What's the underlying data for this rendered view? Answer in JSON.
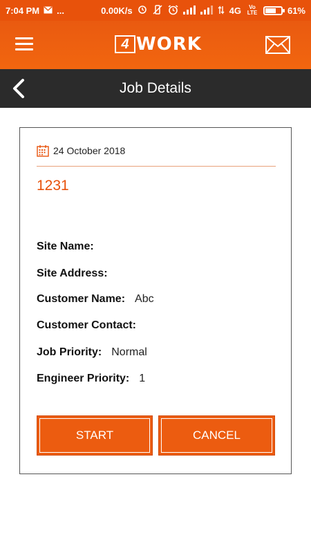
{
  "status_bar": {
    "time": "7:04 PM",
    "dots": "...",
    "speed": "0.00K/s",
    "network": "4G",
    "volte": "Vo LTE",
    "battery": "61%",
    "battery_level": 0.61
  },
  "app_bar": {
    "logo_box": "4",
    "logo_text": "WORK"
  },
  "title_bar": {
    "title": "Job Details"
  },
  "job": {
    "date": "24 October 2018",
    "number": "1231",
    "fields": [
      {
        "label": "Site Name:",
        "value": ""
      },
      {
        "label": "Site Address:",
        "value": ""
      },
      {
        "label": "Customer Name:",
        "value": "Abc"
      },
      {
        "label": "Customer Contact:",
        "value": ""
      },
      {
        "label": "Job Priority:",
        "value": "Normal"
      },
      {
        "label": "Engineer Priority:",
        "value": "1"
      }
    ]
  },
  "actions": {
    "start_label": "START",
    "cancel_label": "CANCEL"
  },
  "colors": {
    "accent": "#e8520b",
    "title_bar": "#2b2b2b"
  },
  "icons": [
    "menu-icon",
    "mail-icon",
    "back-arrow-icon",
    "calendar-icon"
  ]
}
